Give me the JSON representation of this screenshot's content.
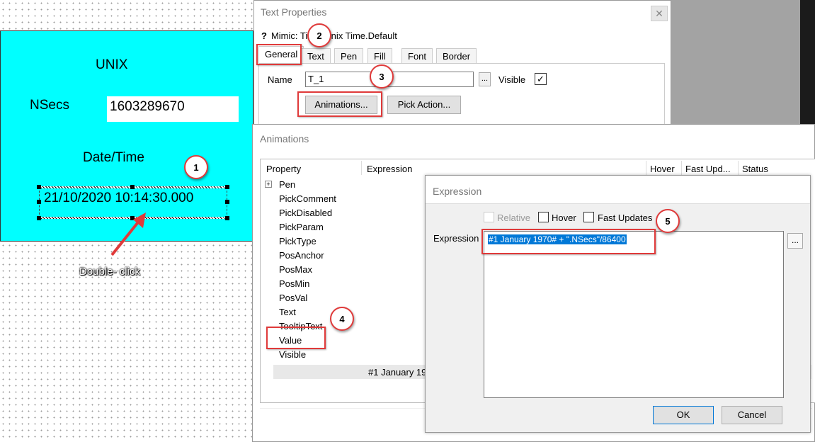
{
  "canvas": {
    "title_text": "UNIX",
    "nsecs_label": "NSecs",
    "nsecs_value": "1603289670",
    "datetime_label": "Date/Time",
    "datetime_value": "21/10/2020 10:14:30.000",
    "double_click_label": "Double- click"
  },
  "annotations": {
    "n1": "1",
    "n2": "2",
    "n3": "3",
    "n4": "4",
    "n5": "5"
  },
  "text_properties": {
    "title": "Text Properties",
    "close": "✕",
    "help": "?",
    "mimic_label": "Mimic: ",
    "mimic_prefix": "Ti",
    "mimic_suffix": "Unix Time.Default",
    "tabs": [
      "General",
      "Text",
      "Pen",
      "Fill",
      "Font",
      "Border"
    ],
    "name_label": "Name",
    "name_value": "T_1",
    "browse": "...",
    "visible_label": "Visible",
    "visible_check": "✓",
    "animations_button": "Animations...",
    "pick_action_button": "Pick Action..."
  },
  "animations": {
    "title": "Animations",
    "columns": [
      "Property",
      "Expression",
      "Hover",
      "Fast Upd...",
      "Status"
    ],
    "expand": "+",
    "properties": [
      "Pen",
      "PickComment",
      "PickDisabled",
      "PickParam",
      "PickType",
      "PosAnchor",
      "PosMax",
      "PosMin",
      "PosVal",
      "Text",
      "TooltipText",
      "Value",
      "Visible"
    ],
    "value_expression": "#1 January 19"
  },
  "expression": {
    "title": "Expression",
    "relative_label": "Relative",
    "hover_label": "Hover",
    "fast_updates_label": "Fast Updates",
    "expression_label": "Expression",
    "expression_value": "#1 January 1970# + \".NSecs\"/86400",
    "browse": "...",
    "ok": "OK",
    "cancel": "Cancel"
  },
  "colors": {
    "mimic_bg": "#00ffff",
    "annotation_red": "#e03a3a",
    "selection_blue": "#0078d7"
  }
}
